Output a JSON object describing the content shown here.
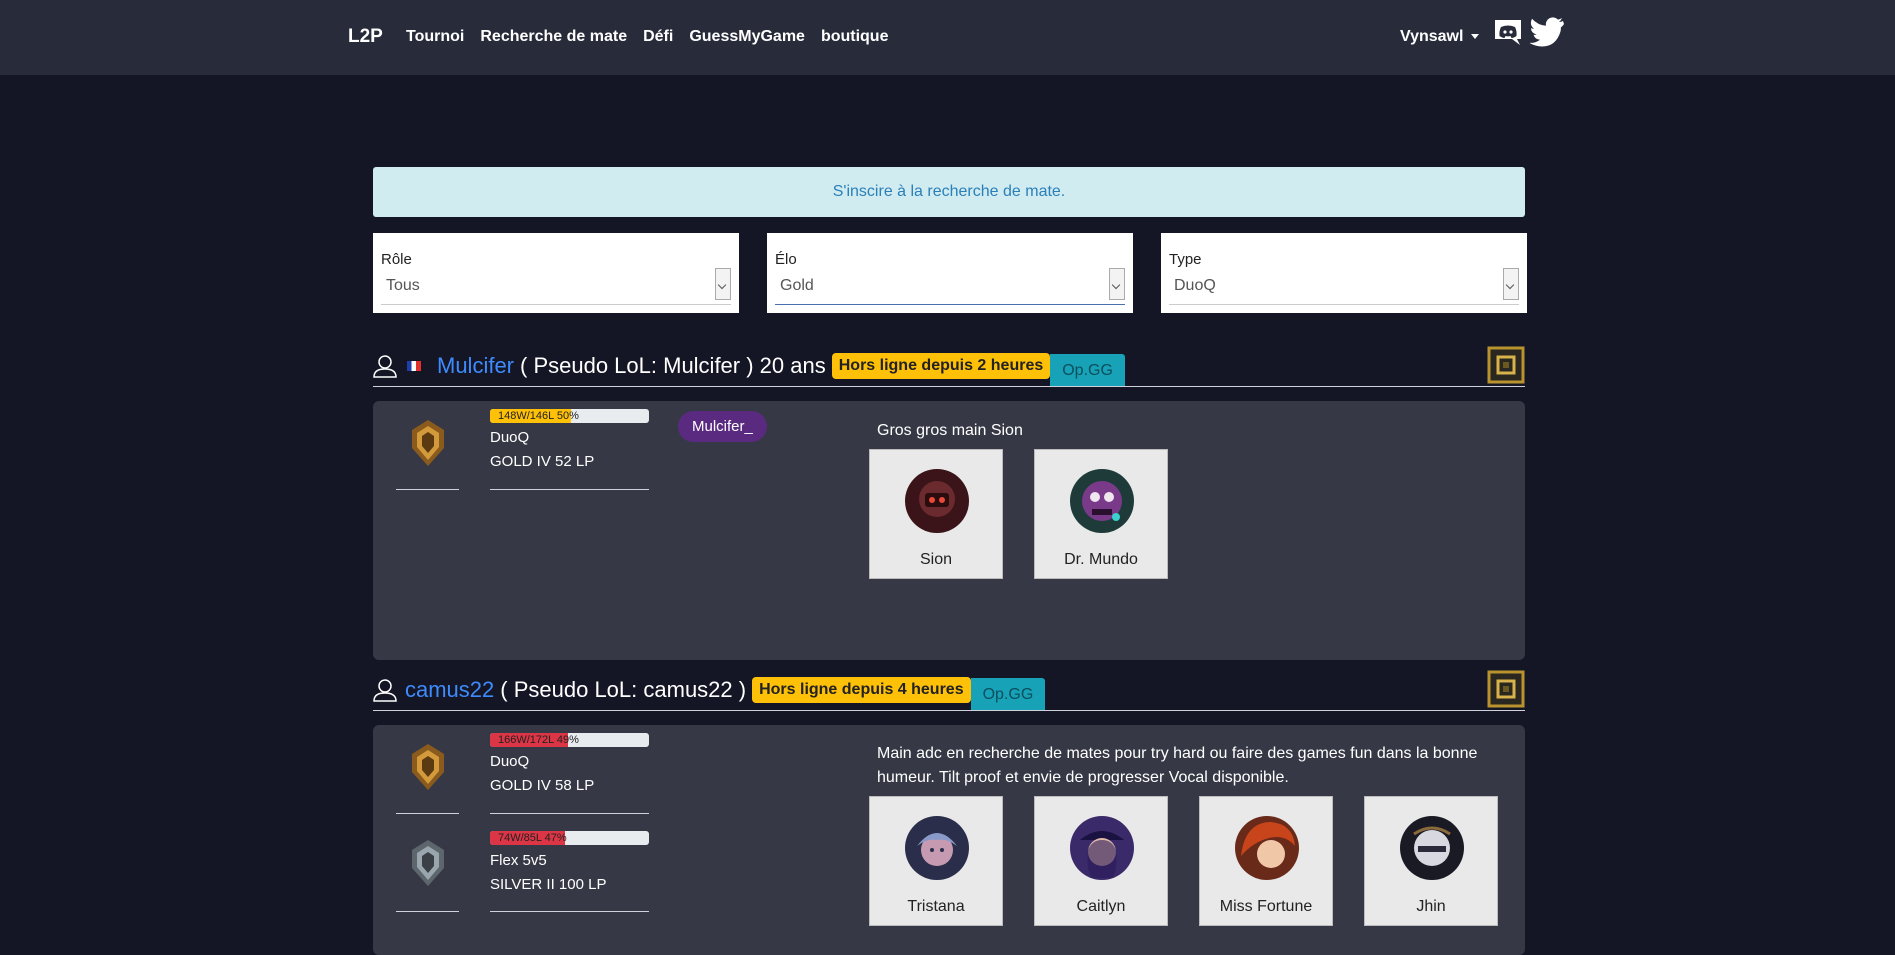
{
  "nav": {
    "brand": "L2P",
    "links": [
      "Tournoi",
      "Recherche de mate",
      "Défi",
      "GuessMyGame",
      "boutique"
    ],
    "username": "Vynsawl",
    "icons": [
      "discord-icon",
      "twitter-icon"
    ]
  },
  "alert": {
    "text": "S'inscire à la recherche de mate."
  },
  "filters": [
    {
      "label": "Rôle",
      "value": "Tous"
    },
    {
      "label": "Élo",
      "value": "Gold"
    },
    {
      "label": "Type",
      "value": "DuoQ"
    }
  ],
  "players": [
    {
      "name": "Mulcifer",
      "info": "( Pseudo LoL: Mulcifer ) 20 ans",
      "status": "Hors ligne depuis 2 heures",
      "opgg": "Op.GG",
      "discord": "Mulcifer_",
      "description": "Gros gros main Sion",
      "ranks": [
        {
          "winloss": "148W/146L 50%",
          "winrate": 0.5,
          "bar_color": "#ffc107",
          "queue": "DuoQ",
          "rank": "GOLD IV 52 LP",
          "tier": "gold"
        }
      ],
      "champions": [
        "Sion",
        "Dr. Mundo"
      ]
    },
    {
      "name": "camus22",
      "info": "( Pseudo LoL: camus22 )",
      "status": "Hors ligne depuis 4 heures",
      "opgg": "Op.GG",
      "description": "Main adc en recherche de mates pour try hard ou faire des games fun dans la bonne humeur. Tilt proof et envie de progresser Vocal disponible.",
      "ranks": [
        {
          "winloss": "166W/172L 49%",
          "winrate": 0.49,
          "bar_color": "#dc3545",
          "queue": "DuoQ",
          "rank": "GOLD IV 58 LP",
          "tier": "gold"
        },
        {
          "winloss": "74W/85L 47%",
          "winrate": 0.47,
          "bar_color": "#dc3545",
          "queue": "Flex 5v5",
          "rank": "SILVER II 100 LP",
          "tier": "silver"
        }
      ],
      "champions": [
        "Tristana",
        "Caitlyn",
        "Miss Fortune",
        "Jhin"
      ]
    }
  ],
  "colors": {
    "navbar": "#272b3a",
    "background": "#151625",
    "card": "#363945",
    "name_link": "#3d8bfd",
    "status_badge": "#ffc107",
    "opgg_badge": "#17a2b8",
    "discord_tag": "#5a2a80"
  }
}
